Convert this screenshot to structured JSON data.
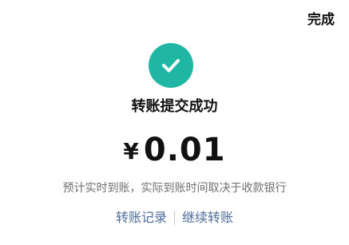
{
  "header": {
    "done_label": "完成"
  },
  "result": {
    "icon": "check-circle-icon",
    "accent_color": "#1fb7a3",
    "title": "转账提交成功",
    "currency_symbol": "¥",
    "amount": "0.01",
    "note": "预计实时到账，实际到账时间取决于收款银行"
  },
  "links": {
    "record_label": "转账记录",
    "continue_label": "继续转账",
    "link_color": "#4f6d9b"
  }
}
